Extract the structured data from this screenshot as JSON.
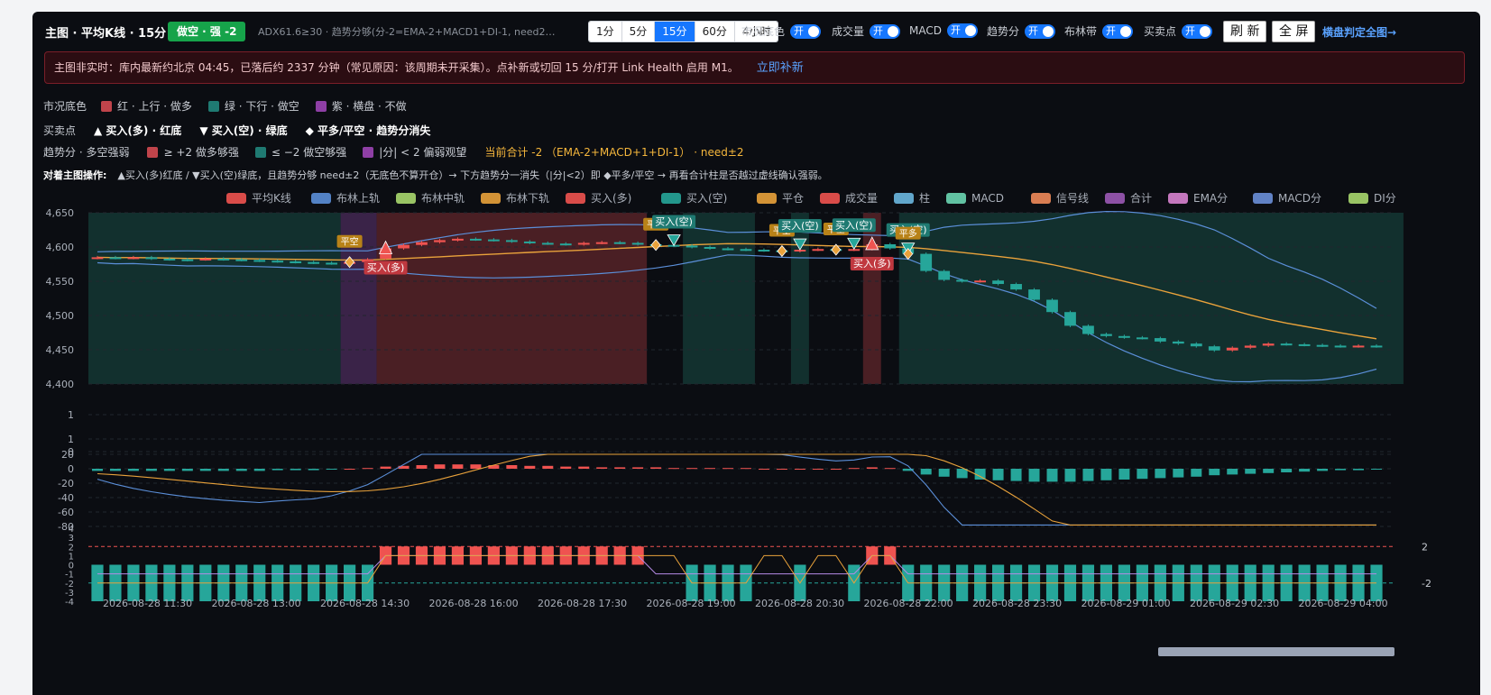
{
  "header": {
    "title": "主图 · 平均K线 · 15分",
    "badge": "做空 · 强 -2",
    "summary": "ADX61.6≥30 · 趋势分够(分-2=EMA-2+MACD1+DI-1, need2) →..."
  },
  "timeframes": [
    {
      "label": "1分",
      "active": false
    },
    {
      "label": "5分",
      "active": false
    },
    {
      "label": "15分",
      "active": true
    },
    {
      "label": "60分",
      "active": false
    },
    {
      "label": "4小时",
      "active": false
    }
  ],
  "toggles": {
    "market_bg": "市况底色",
    "volume": "成交量",
    "macd": "MACD",
    "trend": "趋势分",
    "boll": "布林带",
    "signals": "买卖点",
    "on": "开"
  },
  "buttons": {
    "refresh": "刷 新",
    "fullscreen": "全 屏",
    "side_link": "横盘判定全图→"
  },
  "alert": {
    "text": "主图非实时：库内最新约北京 04:45，已落后约 2337 分钟（常见原因：该周期未开采集）。点补新或切回 15 分/打开 Link Health 启用 M1。",
    "action": "立即补新"
  },
  "legend_rows": {
    "bg": {
      "label": "市况底色",
      "items": [
        "红 · 上行 · 做多",
        "绿 · 下行 · 做空",
        "紫 · 横盘 · 不做"
      ]
    },
    "bs": {
      "label": "买卖点",
      "items": [
        "▲ 买入(多) · 红底",
        "▼ 买入(空) · 绿底",
        "◆ 平多/平空 · 趋势分消失"
      ]
    },
    "trend": {
      "label": "趋势分 · 多空强弱",
      "items": [
        "≥ +2 做多够强",
        "≤ −2 做空够强",
        "|分| < 2 偏弱观望"
      ],
      "sum": "当前合计 -2 （EMA-2+MACD+1+DI-1） · need±2"
    },
    "op": {
      "label": "对着主图操作:",
      "text": "▲买入(多)红底 / ▼买入(空)绿底，且趋势分够 need±2（无底色不算开仓）→ 下方趋势分一消失（|分|<2）即 ◆平多/平空 → 再看合计柱是否越过虚线确认强弱。"
    }
  },
  "chart_legend": [
    "平均K线",
    "布林上轨",
    "布林中轨",
    "布林下轨",
    "买入(多)",
    "买入(空)",
    "平仓",
    "成交量",
    "柱",
    "MACD",
    "信号线",
    "合计",
    "EMA分",
    "MACD分",
    "DI分"
  ],
  "colors": {
    "up": "#ef5350",
    "down": "#26a69a",
    "bg_red": "#4a1f24",
    "bg_green": "#12302e",
    "bg_purple": "#3a2348",
    "boll": "#5b8fd9",
    "mid": "#e9a23b",
    "accent": "#1677ff"
  },
  "chart_data": {
    "type": "candlestick",
    "x_ticks": [
      "2026-08-28 11:30",
      "2026-08-28 13:00",
      "2026-08-28 14:30",
      "2026-08-28 16:00",
      "2026-08-28 17:30",
      "2026-08-28 19:00",
      "2026-08-28 20:30",
      "2026-08-28 22:00",
      "2026-08-28 23:30",
      "2026-08-29 01:00",
      "2026-08-29 02:30",
      "2026-08-29 04:00"
    ],
    "price_axis": {
      "ticks": [
        "4,650",
        "4,600",
        "4,550",
        "4,500",
        "4,450",
        "4,400"
      ],
      "ylim": [
        4400,
        4650
      ]
    },
    "volume_axis": {
      "ticks": [
        "1",
        "1",
        "0"
      ]
    },
    "macd_axis": {
      "ticks": [
        "20",
        "0",
        "-20",
        "-40",
        "-60",
        "-80"
      ],
      "ylim": [
        -80,
        20
      ]
    },
    "score_axis": {
      "ticks": [
        "4",
        "3",
        "2",
        "1",
        "0",
        "-1",
        "-2",
        "-3",
        "-4"
      ],
      "ylim": [
        -4,
        4
      ],
      "dashed": [
        2,
        -2
      ],
      "dash_labels": [
        "2",
        "-2"
      ]
    },
    "bg_regions": [
      {
        "from": 0,
        "to": 13,
        "c": "g"
      },
      {
        "from": 14,
        "to": 15,
        "c": "p"
      },
      {
        "from": 16,
        "to": 30,
        "c": "r"
      },
      {
        "from": 33,
        "to": 36,
        "c": "g"
      },
      {
        "from": 39,
        "to": 39,
        "c": "g"
      },
      {
        "from": 43,
        "to": 43,
        "c": "r"
      },
      {
        "from": 45,
        "to": 72,
        "c": "g"
      }
    ],
    "candles": [
      [
        4584,
        4585
      ],
      [
        4585,
        4584
      ],
      [
        4584,
        4585
      ],
      [
        4585,
        4583
      ],
      [
        4583,
        4582
      ],
      [
        4582,
        4581
      ],
      [
        4582,
        4583
      ],
      [
        4583,
        4582
      ],
      [
        4582,
        4581
      ],
      [
        4581,
        4580
      ],
      [
        4580,
        4579
      ],
      [
        4579,
        4578
      ],
      [
        4578,
        4577
      ],
      [
        4577,
        4576
      ],
      [
        4576,
        4578
      ],
      [
        4578,
        4582
      ],
      [
        4583,
        4598
      ],
      [
        4598,
        4603
      ],
      [
        4603,
        4607
      ],
      [
        4607,
        4610
      ],
      [
        4610,
        4612
      ],
      [
        4612,
        4611
      ],
      [
        4611,
        4610
      ],
      [
        4610,
        4608
      ],
      [
        4608,
        4606
      ],
      [
        4606,
        4605
      ],
      [
        4605,
        4604
      ],
      [
        4604,
        4606
      ],
      [
        4606,
        4607
      ],
      [
        4607,
        4606
      ],
      [
        4606,
        4604
      ],
      [
        4604,
        4603
      ],
      [
        4603,
        4602
      ],
      [
        4602,
        4600
      ],
      [
        4600,
        4598
      ],
      [
        4598,
        4597
      ],
      [
        4597,
        4596
      ],
      [
        4596,
        4595
      ],
      [
        4595,
        4594
      ],
      [
        4594,
        4596
      ],
      [
        4596,
        4597
      ],
      [
        4597,
        4596
      ],
      [
        4596,
        4597
      ],
      [
        4597,
        4604
      ],
      [
        4604,
        4598
      ],
      [
        4598,
        4590
      ],
      [
        4590,
        4565
      ],
      [
        4565,
        4552
      ],
      [
        4552,
        4550
      ],
      [
        4550,
        4551
      ],
      [
        4551,
        4546
      ],
      [
        4546,
        4538
      ],
      [
        4538,
        4523
      ],
      [
        4523,
        4505
      ],
      [
        4505,
        4485
      ],
      [
        4485,
        4473
      ],
      [
        4473,
        4470
      ],
      [
        4470,
        4468
      ],
      [
        4468,
        4467
      ],
      [
        4467,
        4462
      ],
      [
        4462,
        4459
      ],
      [
        4459,
        4455
      ],
      [
        4455,
        4449
      ],
      [
        4449,
        4453
      ],
      [
        4453,
        4456
      ],
      [
        4456,
        4459
      ],
      [
        4459,
        4458
      ],
      [
        4458,
        4457
      ],
      [
        4457,
        4456
      ],
      [
        4456,
        4455
      ],
      [
        4455,
        4456
      ],
      [
        4456,
        4455
      ]
    ],
    "markers": [
      {
        "i": 14,
        "type": "close",
        "label": "平空"
      },
      {
        "i": 16,
        "type": "buy_long",
        "label": "买入(多)"
      },
      {
        "i": 31,
        "type": "close",
        "label": "平多"
      },
      {
        "i": 32,
        "type": "buy_short",
        "label": "买入(空)"
      },
      {
        "i": 38,
        "type": "close",
        "label": "平空"
      },
      {
        "i": 39,
        "type": "buy_short",
        "label": "买入(空)"
      },
      {
        "i": 41,
        "type": "close",
        "label": "平空"
      },
      {
        "i": 42,
        "type": "buy_short",
        "label": "买入(空)"
      },
      {
        "i": 43,
        "type": "buy_long",
        "label": "买入(多)"
      },
      {
        "i": 45,
        "type": "buy_short",
        "label": "买入(空)"
      },
      {
        "i": 45,
        "type": "close",
        "label": "平多"
      }
    ],
    "macd_hist": [
      -3,
      -3,
      -3,
      -3,
      -3,
      -3,
      -3,
      -3,
      -3,
      -3,
      -2,
      -2,
      -2,
      -1,
      0,
      1,
      3,
      4,
      5,
      6,
      6,
      6,
      5,
      5,
      4,
      4,
      3,
      3,
      2,
      2,
      2,
      2,
      1,
      1,
      1,
      1,
      1,
      0,
      0,
      0,
      0,
      0,
      1,
      2,
      1,
      -3,
      -8,
      -11,
      -13,
      -15,
      -16,
      -17,
      -18,
      -18,
      -18,
      -17,
      -16,
      -15,
      -14,
      -13,
      -12,
      -11,
      -9,
      -8,
      -7,
      -6,
      -5,
      -4,
      -3,
      -2,
      -2,
      -1
    ],
    "score": [
      -2,
      -2,
      -2,
      -2,
      -2,
      -2,
      -2,
      -2,
      -2,
      -2,
      -2,
      -2,
      -2,
      -2,
      -2,
      -2,
      2,
      2,
      2,
      2,
      2,
      2,
      2,
      2,
      2,
      2,
      2,
      2,
      2,
      2,
      2,
      0,
      0,
      -2,
      -2,
      -2,
      -2,
      0,
      0,
      -2,
      0,
      0,
      -1,
      2,
      2,
      -2,
      -2,
      -2,
      -2,
      -2,
      -2,
      -2,
      -2,
      -2,
      -2,
      -2,
      -2,
      -2,
      -2,
      -2,
      -2,
      -2,
      -2,
      -2,
      -2,
      -2,
      -2,
      -2,
      -2,
      -2,
      -2,
      -2
    ]
  }
}
